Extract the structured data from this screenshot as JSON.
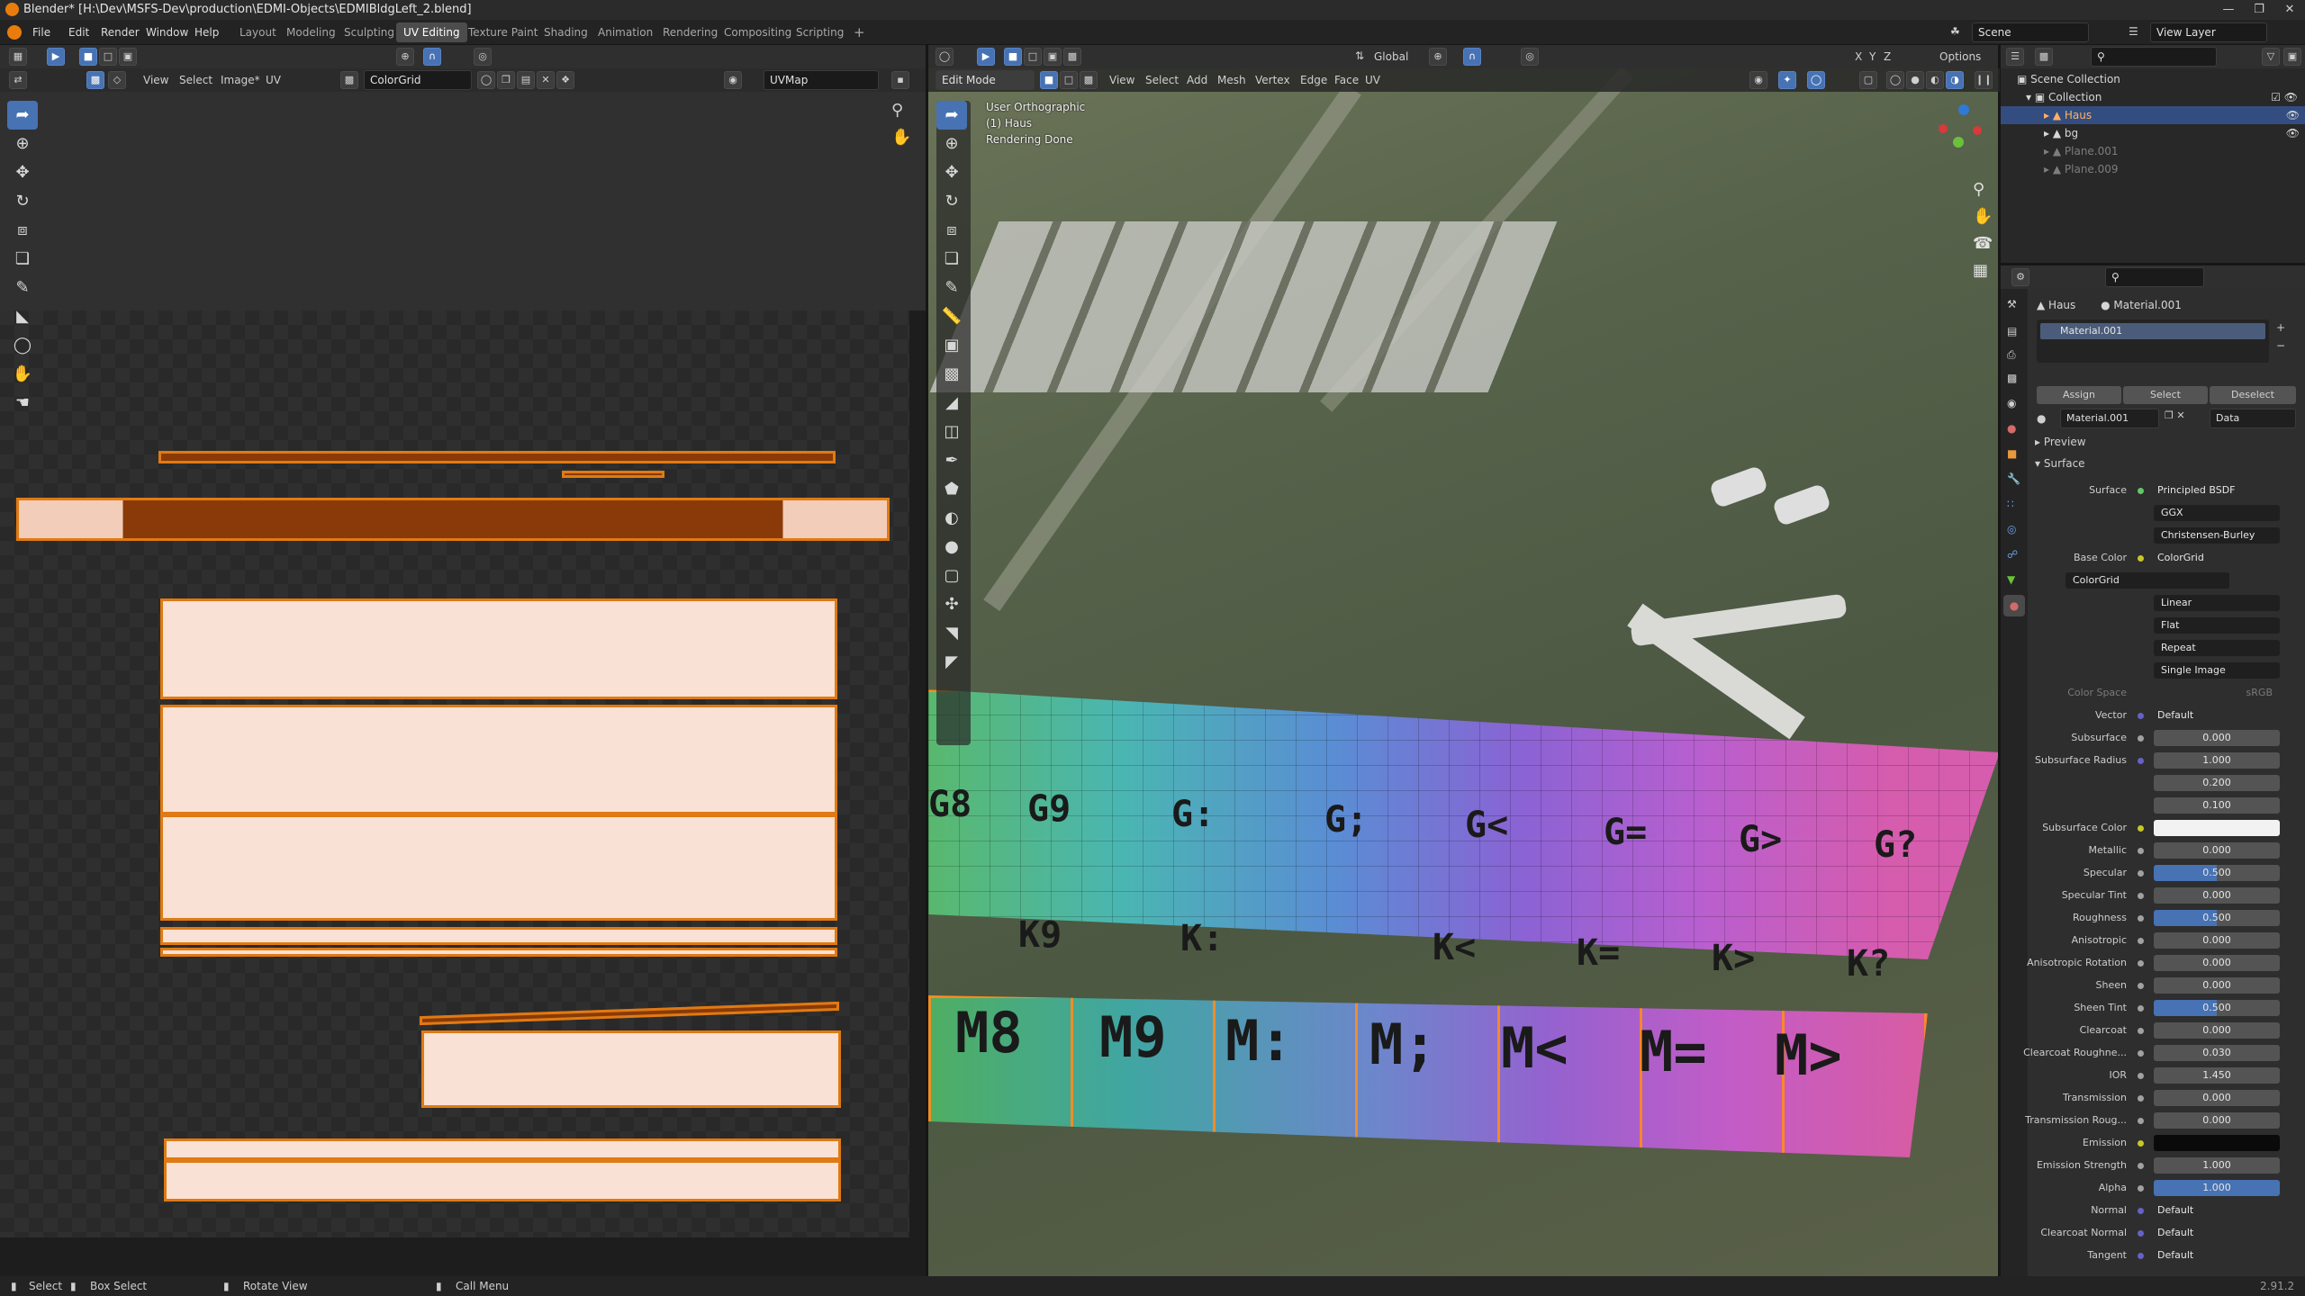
{
  "title_bar": {
    "text": "Blender* [H:\\Dev\\MSFS-Dev\\production\\EDMI-Objects\\EDMIBldgLeft_2.blend]"
  },
  "menus": [
    "File",
    "Edit",
    "Render",
    "Window",
    "Help"
  ],
  "workspaces": [
    "Layout",
    "Modeling",
    "Sculpting",
    "UV Editing",
    "Texture Paint",
    "Shading",
    "Animation",
    "Rendering",
    "Compositing",
    "Scripting"
  ],
  "active_workspace": "UV Editing",
  "scene_field": "Scene",
  "viewlayer_field": "View Layer",
  "uv_editor": {
    "menus": [
      "View",
      "Select",
      "Image*",
      "UV"
    ],
    "image_name": "ColorGrid",
    "uvmap": "UVMap"
  },
  "viewport": {
    "mode": "Edit Mode",
    "menus": [
      "View",
      "Select",
      "Add",
      "Mesh",
      "Vertex",
      "Edge",
      "Face",
      "UV"
    ],
    "orientation": "Global",
    "options_label": "Options",
    "overlay_lines": [
      "User Orthographic",
      "(1) Haus",
      "Rendering Done"
    ],
    "axes": [
      "X",
      "Y",
      "Z"
    ],
    "grid_labels_row1": [
      "G8",
      "G9",
      "G:",
      "G;",
      "G<",
      "G=",
      "G>",
      "G?"
    ],
    "grid_labels_row2": [
      "K9",
      "K:",
      "K<",
      "K=",
      "K>",
      "K?"
    ],
    "grid_labels_row3": [
      "M8",
      "M9",
      "M:",
      "M;",
      "M<",
      "M=",
      "M>"
    ]
  },
  "outliner": {
    "items": [
      {
        "label": "Scene Collection"
      },
      {
        "label": "Collection"
      },
      {
        "label": "Haus"
      },
      {
        "label": "bg"
      },
      {
        "label": "Plane.001"
      },
      {
        "label": "Plane.009"
      }
    ]
  },
  "properties": {
    "object": "Haus",
    "material": "Material.001",
    "slot": "Material.001",
    "buttons": [
      "Assign",
      "Select",
      "Deselect"
    ],
    "data_label": "Data",
    "panels": [
      "Preview",
      "Surface"
    ],
    "rows": [
      {
        "label": "Surface",
        "value": "Principled BSDF",
        "kind": "link",
        "dot": "#63c763"
      },
      {
        "label": "",
        "value": "GGX",
        "kind": "drop"
      },
      {
        "label": "",
        "value": "Christensen-Burley",
        "kind": "drop"
      },
      {
        "label": "Base Color",
        "value": "ColorGrid",
        "kind": "link",
        "dot": "#c7c729"
      },
      {
        "label": "",
        "value": "ColorGrid",
        "kind": "image"
      },
      {
        "label": "",
        "value": "Linear",
        "kind": "drop"
      },
      {
        "label": "",
        "value": "Flat",
        "kind": "drop"
      },
      {
        "label": "",
        "value": "Repeat",
        "kind": "drop"
      },
      {
        "label": "",
        "value": "Single Image",
        "kind": "drop"
      },
      {
        "label": "Color Space",
        "value": "sRGB",
        "kind": "dim"
      },
      {
        "label": "Vector",
        "value": "Default",
        "kind": "link",
        "dot": "#6363c7"
      },
      {
        "label": "Subsurface",
        "value": "0.000",
        "kind": "num",
        "dot": "#a1a1a1"
      },
      {
        "label": "Subsurface Radius",
        "value": "1.000",
        "kind": "num",
        "dot": "#6363c7"
      },
      {
        "label": "",
        "value": "0.200",
        "kind": "num"
      },
      {
        "label": "",
        "value": "0.100",
        "kind": "num"
      },
      {
        "label": "Subsurface Color",
        "value": "",
        "kind": "white",
        "dot": "#c7c729"
      },
      {
        "label": "Metallic",
        "value": "0.000",
        "kind": "num",
        "dot": "#a1a1a1"
      },
      {
        "label": "Specular",
        "value": "0.500",
        "kind": "half",
        "dot": "#a1a1a1"
      },
      {
        "label": "Specular Tint",
        "value": "0.000",
        "kind": "num",
        "dot": "#a1a1a1"
      },
      {
        "label": "Roughness",
        "value": "0.500",
        "kind": "half",
        "dot": "#a1a1a1"
      },
      {
        "label": "Anisotropic",
        "value": "0.000",
        "kind": "num",
        "dot": "#a1a1a1"
      },
      {
        "label": "Anisotropic Rotation",
        "value": "0.000",
        "kind": "num",
        "dot": "#a1a1a1"
      },
      {
        "label": "Sheen",
        "value": "0.000",
        "kind": "num",
        "dot": "#a1a1a1"
      },
      {
        "label": "Sheen Tint",
        "value": "0.500",
        "kind": "half",
        "dot": "#a1a1a1"
      },
      {
        "label": "Clearcoat",
        "value": "0.000",
        "kind": "num",
        "dot": "#a1a1a1"
      },
      {
        "label": "Clearcoat Roughne...",
        "value": "0.030",
        "kind": "num",
        "dot": "#a1a1a1"
      },
      {
        "label": "IOR",
        "value": "1.450",
        "kind": "num",
        "dot": "#a1a1a1"
      },
      {
        "label": "Transmission",
        "value": "0.000",
        "kind": "num",
        "dot": "#a1a1a1"
      },
      {
        "label": "Transmission Roug...",
        "value": "0.000",
        "kind": "num",
        "dot": "#a1a1a1"
      },
      {
        "label": "Emission",
        "value": "",
        "kind": "black",
        "dot": "#c7c729"
      },
      {
        "label": "Emission Strength",
        "value": "1.000",
        "kind": "num",
        "dot": "#a1a1a1"
      },
      {
        "label": "Alpha",
        "value": "1.000",
        "kind": "full",
        "dot": "#a1a1a1"
      },
      {
        "label": "Normal",
        "value": "Default",
        "kind": "link",
        "dot": "#6363c7"
      },
      {
        "label": "Clearcoat Normal",
        "value": "Default",
        "kind": "link",
        "dot": "#6363c7"
      },
      {
        "label": "Tangent",
        "value": "Default",
        "kind": "link",
        "dot": "#6363c7"
      }
    ]
  },
  "status": {
    "items": [
      "Select",
      "Box Select",
      "Rotate View",
      "Call Menu"
    ],
    "version": "2.91.2"
  }
}
